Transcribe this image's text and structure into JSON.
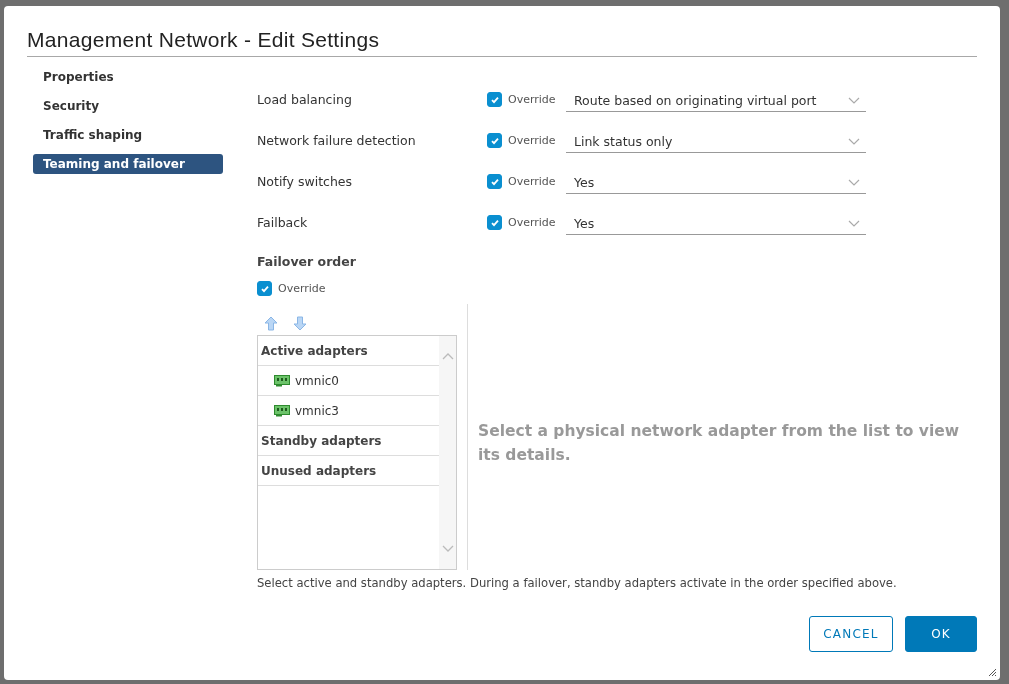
{
  "dialog": {
    "title": "Management Network - Edit Settings"
  },
  "nav": [
    {
      "label": "Properties",
      "selected": false
    },
    {
      "label": "Security",
      "selected": false
    },
    {
      "label": "Traffic shaping",
      "selected": false
    },
    {
      "label": "Teaming and failover",
      "selected": true
    }
  ],
  "settings": [
    {
      "label": "Load balancing",
      "override_label": "Override",
      "checked": true,
      "value": "Route based on originating virtual port"
    },
    {
      "label": "Network failure detection",
      "override_label": "Override",
      "checked": true,
      "value": "Link status only"
    },
    {
      "label": "Notify switches",
      "override_label": "Override",
      "checked": true,
      "value": "Yes"
    },
    {
      "label": "Failback",
      "override_label": "Override",
      "checked": true,
      "value": "Yes"
    }
  ],
  "failover_order": {
    "heading": "Failover order",
    "override_label": "Override",
    "checked": true,
    "groups": [
      {
        "label": "Active adapters",
        "adapters": [
          "vmnic0",
          "vmnic3"
        ]
      },
      {
        "label": "Standby adapters"
      },
      {
        "label": "Unused adapters"
      }
    ],
    "details_hint": "Select a physical network adapter from the list to view its details.",
    "note": "Select active and standby adapters. During a failover, standby adapters activate in the order specified above."
  },
  "buttons": [
    {
      "label": "CANCEL",
      "kind": "secondary"
    },
    {
      "label": "OK",
      "kind": "primary"
    }
  ]
}
